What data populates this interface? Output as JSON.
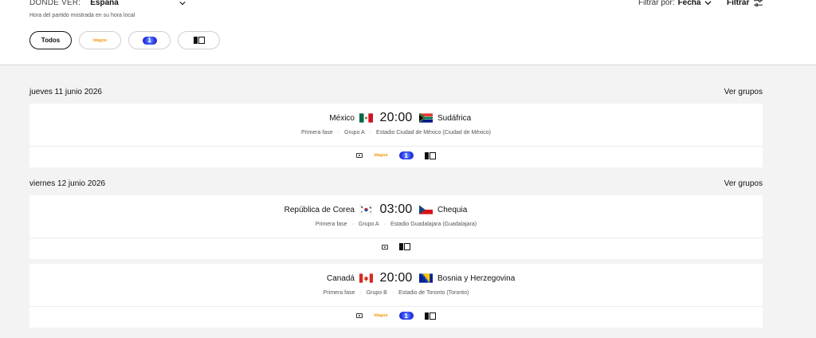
{
  "filters": {
    "where_label": "DÓNDE VER:",
    "country": "España",
    "note": "Hora del partido mostrada en su hora local",
    "filter_by_label": "Filtrar por:",
    "filter_by_value": "Fecha",
    "filter_button": "Filtrar",
    "chips": [
      {
        "label": "Todos",
        "active": true
      },
      {
        "label": "",
        "logo": "tdn-logo"
      },
      {
        "label": "1",
        "logo": "la1-logo"
      },
      {
        "label": "",
        "logo": "square-channel-logo"
      }
    ]
  },
  "days": [
    {
      "date": "jueves 11 junio 2026",
      "groups_link": "Ver grupos",
      "matches": [
        {
          "home": "México",
          "home_flag": "mexico-flag",
          "time": "20:00",
          "away": "Sudáfrica",
          "away_flag": "south-africa-flag",
          "phase": "Primera fase",
          "group": "Grupo A",
          "venue": "Estadio Ciudad de México (Ciudad de México)",
          "channels": [
            "tv-icon",
            "tdn-logo",
            "la1-logo",
            "square-channel-logo"
          ]
        }
      ]
    },
    {
      "date": "viernes 12 junio 2026",
      "groups_link": "Ver grupos",
      "matches": [
        {
          "home": "República de Corea",
          "home_flag": "south-korea-flag",
          "time": "03:00",
          "away": "Chequia",
          "away_flag": "czechia-flag",
          "phase": "Primera fase",
          "group": "Grupo A",
          "venue": "Estadio Guadalajara (Guadalajara)",
          "channels": [
            "tv-icon",
            "square-channel-logo"
          ]
        },
        {
          "home": "Canadá",
          "home_flag": "canada-flag",
          "time": "20:00",
          "away": "Bosnia y Herzegovina",
          "away_flag": "bosnia-flag",
          "phase": "Primera fase",
          "group": "Grupo B",
          "venue": "Estadio de Toronto (Toronto)",
          "channels": [
            "tv-icon",
            "tdn-logo",
            "la1-logo",
            "square-channel-logo"
          ]
        }
      ]
    }
  ],
  "logos": {
    "tdn_text": "tdagoo"
  },
  "colors": {
    "tdn_orange": "#f39200",
    "la1_blue": "#2b3df0",
    "page_bg": "#f3f3f3"
  }
}
